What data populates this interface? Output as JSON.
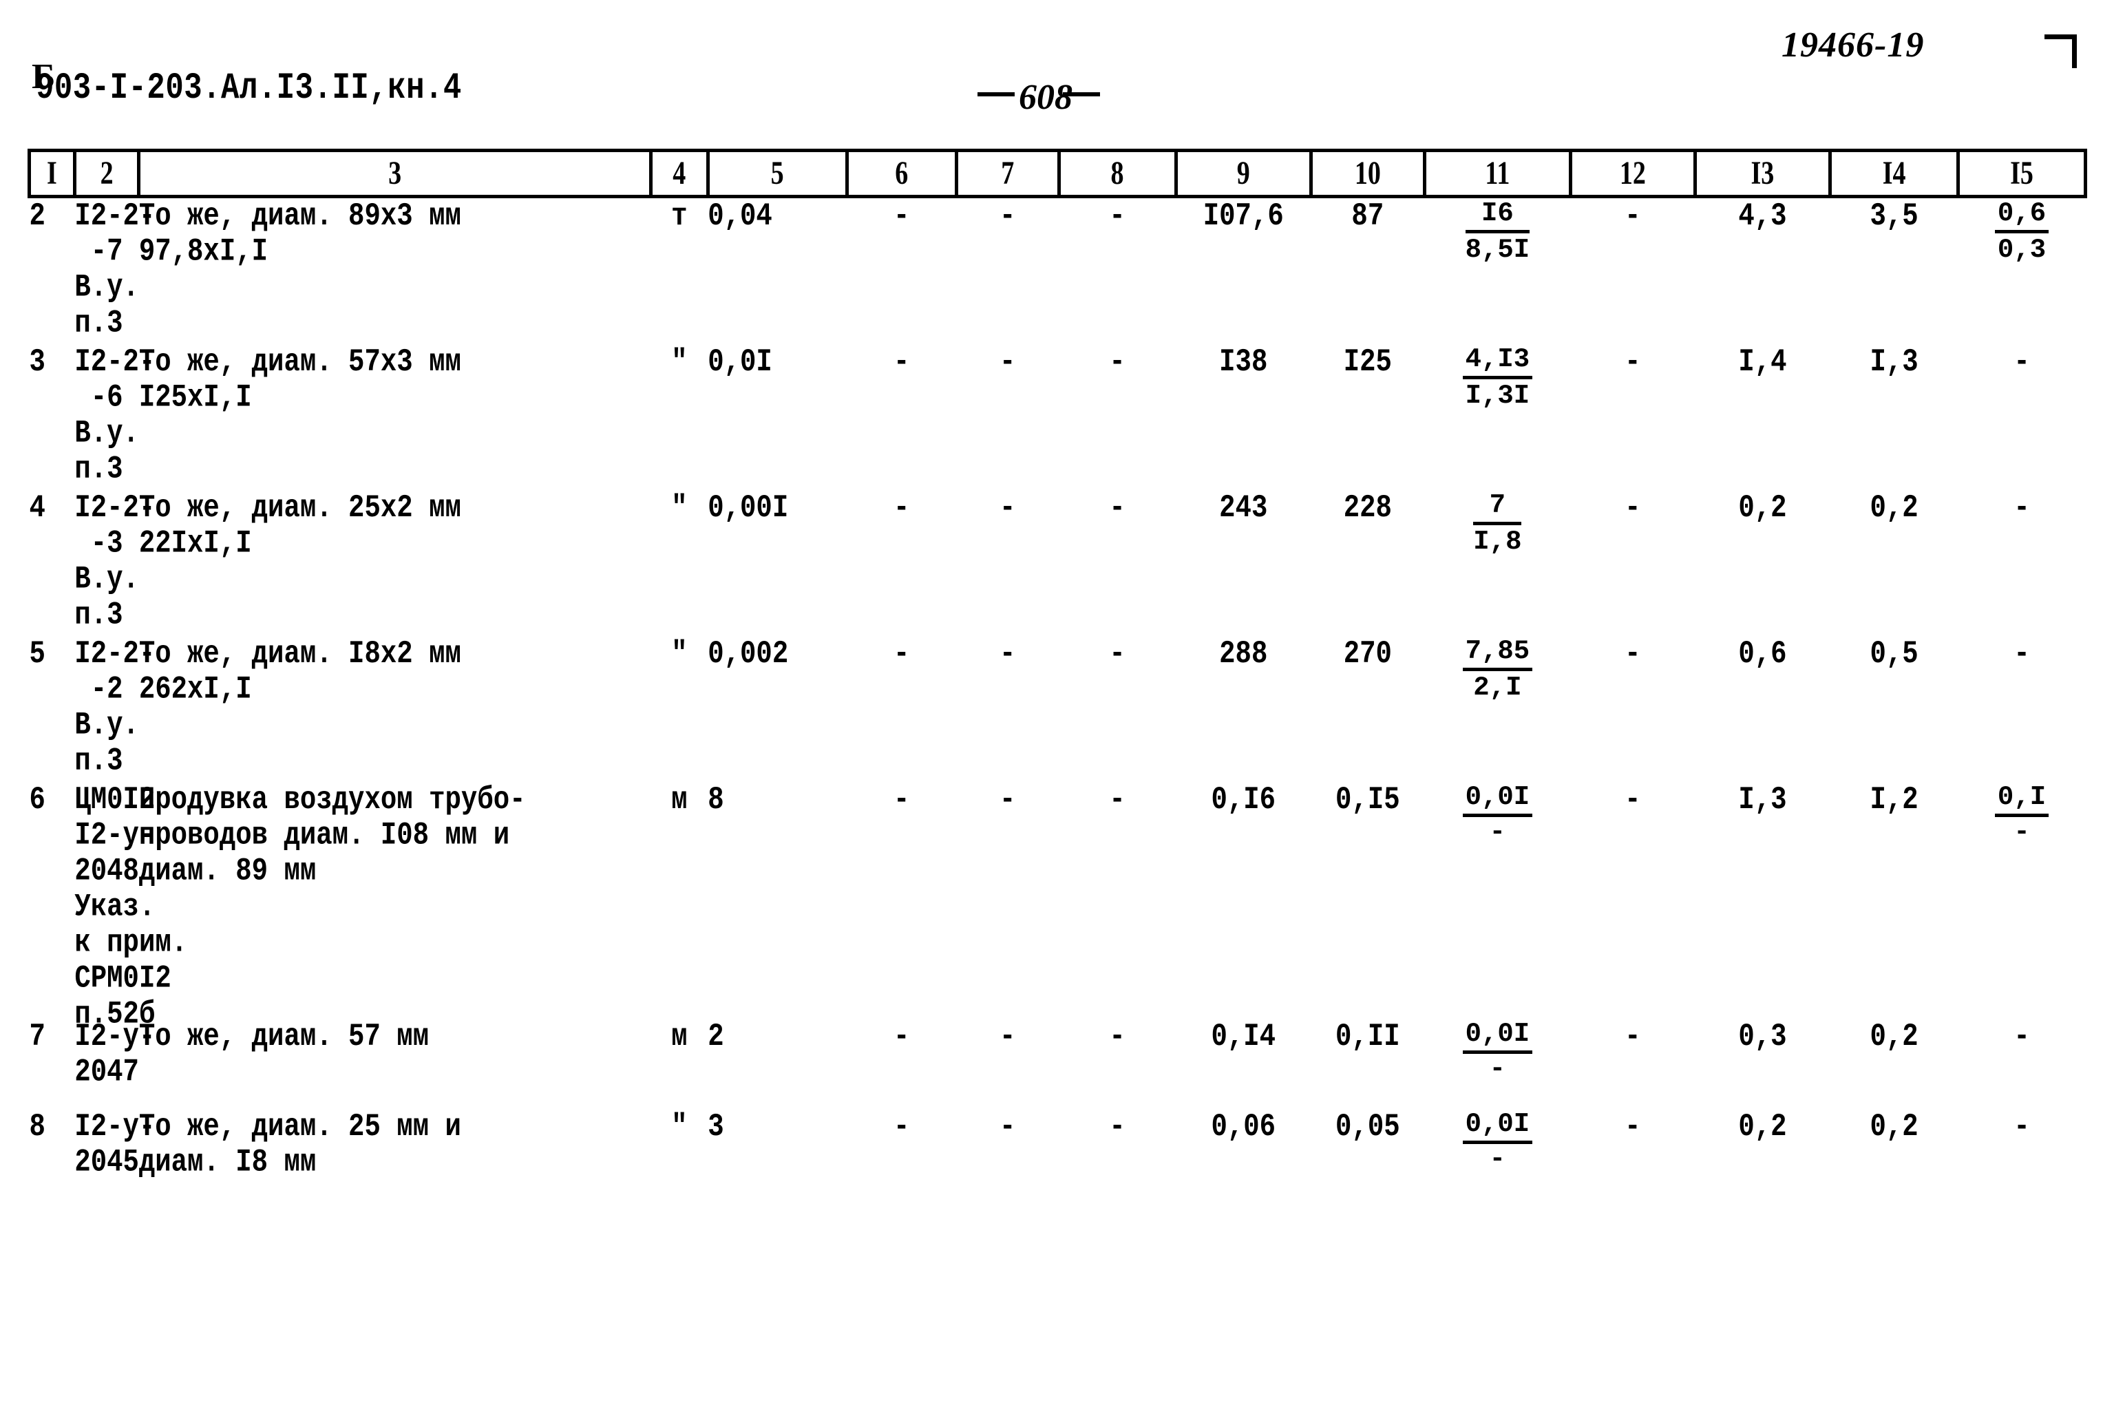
{
  "header": {
    "code_prefix": "Б",
    "document_code": "903-I-203.Ал.I3.II,кн.4",
    "page_number": "608",
    "stamp": "19466-19"
  },
  "table": {
    "column_numbers": [
      "I",
      "2",
      "3",
      "4",
      "5",
      "6",
      "7",
      "8",
      "9",
      "10",
      "11",
      "12",
      "I3",
      "I4",
      "I5"
    ],
    "rows": [
      {
        "num": "2",
        "code": "I2-2-\n -7\nВ.у.\nп.3",
        "desc": "То же, диам. 89х3 мм\n97,8хI,I",
        "unit": "т",
        "qty": "0,04",
        "c6": "-",
        "c7": "-",
        "c8": "-",
        "c9": "I07,6",
        "c10": "87",
        "c11_top": "I6",
        "c11_bot": "8,5I",
        "c12": "-",
        "c13": "4,3",
        "c14": "3,5",
        "c15_top": "0,6",
        "c15_bot": "0,3"
      },
      {
        "num": "3",
        "code": "I2-2-\n -6\nВ.у.\nп.3",
        "desc": "То же, диам. 57х3 мм\nI25хI,I",
        "unit": "\"",
        "qty": "0,0I",
        "c6": "-",
        "c7": "-",
        "c8": "-",
        "c9": "I38",
        "c10": "I25",
        "c11_top": "4,I3",
        "c11_bot": "I,3I",
        "c12": "-",
        "c13": "I,4",
        "c14": "I,3",
        "c15_top": "",
        "c15_bot": "",
        "c15_plain": "-"
      },
      {
        "num": "4",
        "code": "I2-2-\n -3\nВ.у.\nп.3",
        "desc": "То же, диам. 25х2 мм\n22IхI,I",
        "unit": "\"",
        "qty": "0,00I",
        "c6": "-",
        "c7": "-",
        "c8": "-",
        "c9": "243",
        "c10": "228",
        "c11_top": "7",
        "c11_bot": "I,8",
        "c12": "-",
        "c13": "0,2",
        "c14": "0,2",
        "c15_plain": "-"
      },
      {
        "num": "5",
        "code": "I2-2-\n -2\nВ.у.\nп.3",
        "desc": "То же, диам. I8х2 мм\n262хI,I",
        "unit": "\"",
        "qty": "0,002",
        "c6": "-",
        "c7": "-",
        "c8": "-",
        "c9": "288",
        "c10": "270",
        "c11_top": "7,85",
        "c11_bot": "2,I",
        "c12": "-",
        "c13": "0,6",
        "c14": "0,5",
        "c15_plain": "-"
      },
      {
        "num": "6",
        "code": "ЦМ0I2\nI2-у-\n2048\nУказ.\nк прим.\nСРМ0I2\nп.52б",
        "desc": "Продувка воздухом трубо-\nпроводов диам. I08 мм и\nдиам. 89 мм",
        "unit": "м",
        "qty": "8",
        "c6": "-",
        "c7": "-",
        "c8": "-",
        "c9": "0,I6",
        "c10": "0,I5",
        "c11_top": "0,0I",
        "c11_bot": "-",
        "c12": "-",
        "c13": "I,3",
        "c14": "I,2",
        "c15_top": "0,I",
        "c15_bot": "-"
      },
      {
        "num": "7",
        "code": "I2-у-\n2047",
        "desc": "То же, диам. 57 мм",
        "unit": "м",
        "qty": "2",
        "c6": "-",
        "c7": "-",
        "c8": "-",
        "c9": "0,I4",
        "c10": "0,II",
        "c11_top": "0,0I",
        "c11_bot": "-",
        "c12": "-",
        "c13": "0,3",
        "c14": "0,2",
        "c15_plain": "-"
      },
      {
        "num": "8",
        "code": "I2-у-\n2045",
        "desc": "То же, диам. 25 мм и\nдиам. I8 мм",
        "unit": "\"",
        "qty": "3",
        "c6": "-",
        "c7": "-",
        "c8": "-",
        "c9": "0,06",
        "c10": "0,05",
        "c11_top": "0,0I",
        "c11_bot": "-",
        "c12": "-",
        "c13": "0,2",
        "c14": "0,2",
        "c15_plain": "-"
      }
    ]
  }
}
